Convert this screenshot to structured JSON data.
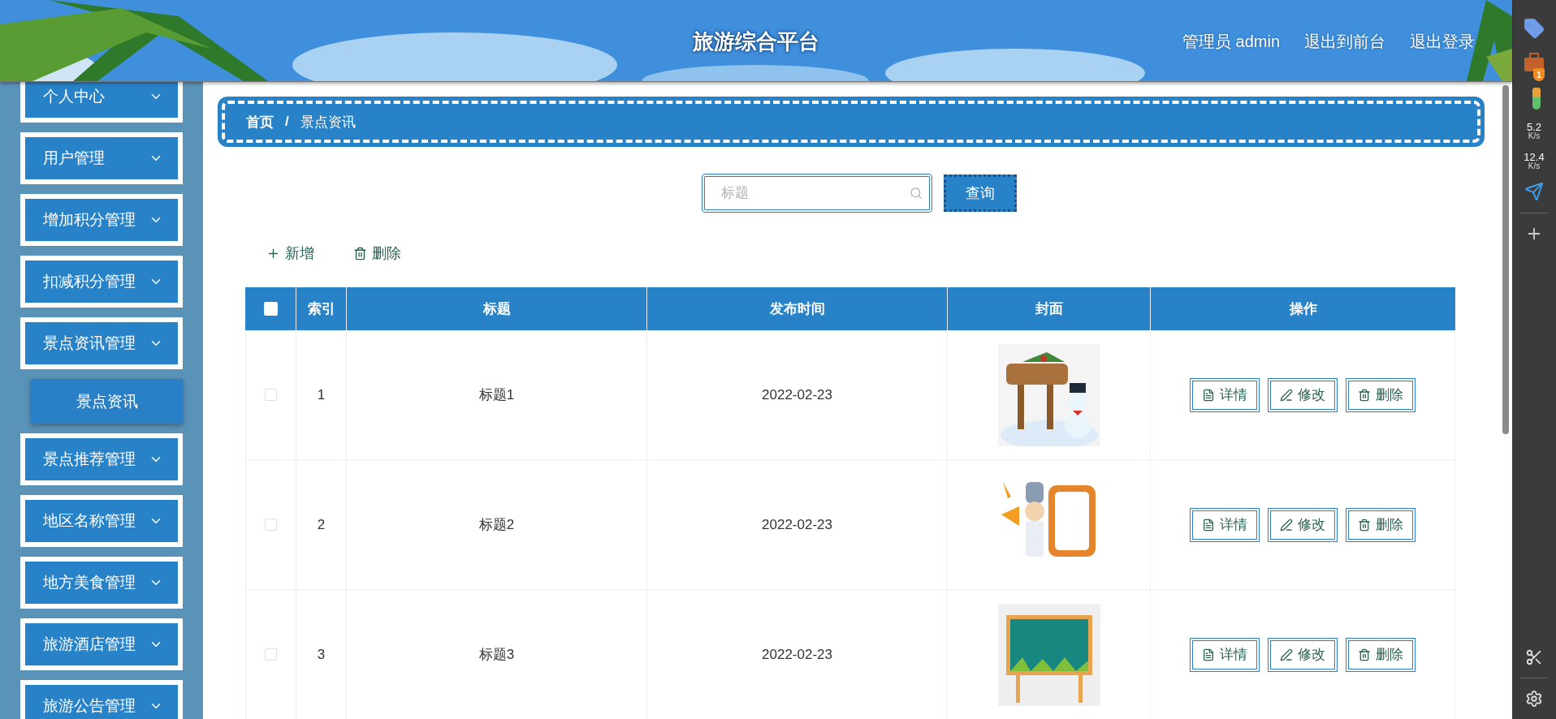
{
  "header": {
    "title": "旅游综合平台",
    "user": "管理员 admin",
    "links": [
      "退出到前台",
      "退出登录"
    ]
  },
  "sidebar": {
    "items": [
      {
        "label": "个人中心"
      },
      {
        "label": "用户管理"
      },
      {
        "label": "增加积分管理"
      },
      {
        "label": "扣减积分管理"
      },
      {
        "label": "景点资讯管理",
        "children": [
          {
            "label": "景点资讯",
            "selected": true
          }
        ]
      },
      {
        "label": "景点推荐管理"
      },
      {
        "label": "地区名称管理"
      },
      {
        "label": "地方美食管理"
      },
      {
        "label": "旅游酒店管理"
      },
      {
        "label": "旅游公告管理"
      }
    ]
  },
  "breadcrumb": {
    "items": [
      "首页",
      "景点资讯"
    ],
    "separator": "/"
  },
  "search": {
    "placeholder": "标题",
    "button": "查询"
  },
  "actions": [
    {
      "kind": "add",
      "label": "新增"
    },
    {
      "kind": "delete",
      "label": "删除"
    }
  ],
  "table": {
    "select_all": {
      "checked": false
    },
    "columns": [
      "索引",
      "标题",
      "发布时间",
      "封面",
      "操作"
    ],
    "rows": [
      {
        "checked": false,
        "index": "1",
        "title": "标题1",
        "date": "2022-02-23",
        "buttons": [
          {
            "kind": "detail",
            "label": "详情"
          },
          {
            "kind": "edit",
            "label": "修改"
          },
          {
            "kind": "delete",
            "label": "删除"
          }
        ]
      },
      {
        "checked": false,
        "index": "2",
        "title": "标题2",
        "date": "2022-02-23",
        "buttons": [
          {
            "kind": "detail",
            "label": "详情"
          },
          {
            "kind": "edit",
            "label": "修改"
          },
          {
            "kind": "delete",
            "label": "删除"
          }
        ]
      },
      {
        "checked": false,
        "index": "3",
        "title": "标题3",
        "date": "2022-02-23",
        "buttons": [
          {
            "kind": "detail",
            "label": "详情"
          },
          {
            "kind": "edit",
            "label": "修改"
          },
          {
            "kind": "delete",
            "label": "删除"
          }
        ]
      }
    ]
  },
  "edge_bar": {
    "speeds": [
      {
        "value": "5.2",
        "unit": "K/s"
      },
      {
        "value": "12.4",
        "unit": "K/s"
      }
    ],
    "badge": "1"
  }
}
